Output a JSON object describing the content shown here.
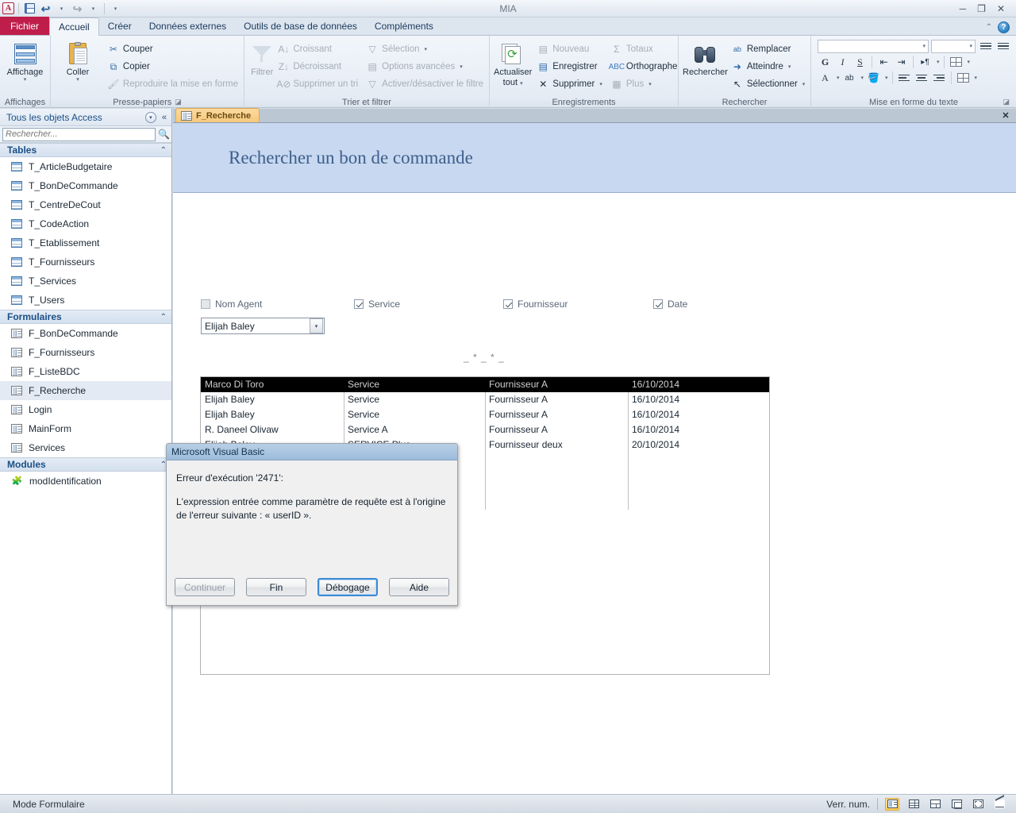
{
  "window": {
    "title": "MIA",
    "minimize": "─",
    "restore": "❐",
    "close": "✕"
  },
  "quick_access": {
    "logo": "A",
    "save": "save-icon",
    "undo": "↩",
    "redo": "↪",
    "customize": "▾"
  },
  "ribbon": {
    "file_tab": "Fichier",
    "tabs": [
      {
        "label": "Accueil",
        "active": true
      },
      {
        "label": "Créer",
        "active": false
      },
      {
        "label": "Données externes",
        "active": false
      },
      {
        "label": "Outils de base de données",
        "active": false
      },
      {
        "label": "Compléments",
        "active": false
      }
    ],
    "collapse_icon": "⌃",
    "help_icon": "?",
    "groups": {
      "views": {
        "label": "Affichages",
        "button": {
          "label": "Affichage",
          "caret": "▾"
        }
      },
      "clipboard": {
        "label": "Presse-papiers",
        "paste": {
          "label": "Coller",
          "caret": "▾"
        },
        "items": [
          {
            "label": "Couper",
            "icon": "scissors-icon",
            "disabled": false
          },
          {
            "label": "Copier",
            "icon": "copy-icon",
            "disabled": false
          },
          {
            "label": "Reproduire la mise en forme",
            "icon": "format-painter-icon",
            "disabled": true
          }
        ]
      },
      "sort_filter": {
        "label": "Trier et filtrer",
        "filter": {
          "label": "Filtrer"
        },
        "col1": [
          {
            "label": "Croissant",
            "icon": "sort-asc-icon",
            "disabled": true
          },
          {
            "label": "Décroissant",
            "icon": "sort-desc-icon",
            "disabled": true
          },
          {
            "label": "Supprimer un tri",
            "icon": "clear-sort-icon",
            "disabled": true
          }
        ],
        "col2": [
          {
            "label": "Sélection",
            "icon": "selection-icon",
            "caret": "▾",
            "disabled": true
          },
          {
            "label": "Options avancées",
            "icon": "advanced-icon",
            "caret": "▾",
            "disabled": true
          },
          {
            "label": "Activer/désactiver le filtre",
            "icon": "toggle-filter-icon",
            "disabled": true
          }
        ]
      },
      "records": {
        "label": "Enregistrements",
        "refresh": {
          "label_line1": "Actualiser",
          "label_line2": "tout",
          "caret": "▾"
        },
        "col1": [
          {
            "label": "Nouveau",
            "icon": "new-record-icon",
            "disabled": true
          },
          {
            "label": "Enregistrer",
            "icon": "save-record-icon",
            "disabled": false
          },
          {
            "label": "Supprimer",
            "icon": "delete-record-icon",
            "caret": "▾",
            "disabled": false
          }
        ],
        "col2": [
          {
            "label": "Totaux",
            "icon": "sigma-icon",
            "disabled": true
          },
          {
            "label": "Orthographe",
            "icon": "spelling-icon",
            "disabled": false
          },
          {
            "label": "Plus",
            "icon": "more-icon",
            "caret": "▾",
            "disabled": true
          }
        ]
      },
      "find": {
        "label": "Rechercher",
        "search": {
          "label": "Rechercher"
        },
        "items": [
          {
            "label": "Remplacer",
            "icon": "replace-icon"
          },
          {
            "label": "Atteindre",
            "icon": "goto-icon",
            "caret": "▾"
          },
          {
            "label": "Sélectionner",
            "icon": "select-icon",
            "caret": "▾"
          }
        ]
      },
      "text_format": {
        "label": "Mise en forme du texte",
        "font_name": "",
        "font_size": "",
        "bold": "G",
        "italic": "I",
        "underline": "S",
        "dropdown_caret": "▾",
        "dialog_launcher": "◪"
      }
    }
  },
  "navpane": {
    "title": "Tous les objets Access",
    "menu_icon": "▾",
    "collapse_icon": "«",
    "search_placeholder": "Rechercher...",
    "search_value": "",
    "search_icon": "search-icon",
    "groups": [
      {
        "name": "Tables",
        "chevron": "⌃",
        "items": [
          {
            "label": "T_ArticleBudgetaire",
            "icon": "table-icon"
          },
          {
            "label": "T_BonDeCommande",
            "icon": "table-icon"
          },
          {
            "label": "T_CentreDeCout",
            "icon": "table-icon"
          },
          {
            "label": "T_CodeAction",
            "icon": "table-icon"
          },
          {
            "label": "T_Etablissement",
            "icon": "table-icon"
          },
          {
            "label": "T_Fournisseurs",
            "icon": "table-icon"
          },
          {
            "label": "T_Services",
            "icon": "table-icon"
          },
          {
            "label": "T_Users",
            "icon": "table-icon"
          }
        ]
      },
      {
        "name": "Formulaires",
        "chevron": "⌃",
        "items": [
          {
            "label": "F_BonDeCommande",
            "icon": "form-icon"
          },
          {
            "label": "F_Fournisseurs",
            "icon": "form-icon"
          },
          {
            "label": "F_ListeBDC",
            "icon": "form-icon"
          },
          {
            "label": "F_Recherche",
            "icon": "form-icon",
            "selected": true
          },
          {
            "label": "Login",
            "icon": "form-icon"
          },
          {
            "label": "MainForm",
            "icon": "form-icon"
          },
          {
            "label": "Services",
            "icon": "form-icon"
          }
        ]
      },
      {
        "name": "Modules",
        "chevron": "⌃",
        "items": [
          {
            "label": "modIdentification",
            "icon": "module-icon"
          }
        ]
      }
    ]
  },
  "document": {
    "tab_label": "F_Recherche",
    "tab_icon": "form-icon",
    "close_icon": "✕",
    "form_title": "Rechercher un bon de commande",
    "separator": "_ * _ * _",
    "criteria": [
      {
        "label": "Nom Agent",
        "checked": false
      },
      {
        "label": "Service",
        "checked": true
      },
      {
        "label": "Fournisseur",
        "checked": true
      },
      {
        "label": "Date",
        "checked": true
      }
    ],
    "combo": {
      "value": "Elijah Baley",
      "caret": "▾"
    },
    "results": {
      "header": [
        "Marco Di Toro",
        "Service",
        "Fournisseur A",
        "16/10/2014"
      ],
      "rows": [
        [
          "Elijah Baley",
          "Service",
          "Fournisseur A",
          "16/10/2014"
        ],
        [
          "Elijah Baley",
          "Service",
          "Fournisseur A",
          "16/10/2014"
        ],
        [
          "R. Daneel Olivaw",
          "Service A",
          "Fournisseur A",
          "16/10/2014"
        ],
        [
          "Elijah Baley",
          "SERVICE Plus",
          "Fournisseur deux",
          "20/10/2014"
        ]
      ]
    }
  },
  "dialog": {
    "title": "Microsoft Visual Basic",
    "line1": "Erreur d'exécution '2471':",
    "line2": "L'expression entrée comme paramètre de requête est à l'origine de l'erreur suivante : « userID ».",
    "buttons": [
      {
        "label": "Continuer",
        "disabled": true,
        "focused": false
      },
      {
        "label": "Fin",
        "disabled": false,
        "focused": false
      },
      {
        "label": "Débogage",
        "disabled": false,
        "focused": true
      },
      {
        "label": "Aide",
        "disabled": false,
        "focused": false
      }
    ]
  },
  "statusbar": {
    "mode": "Mode Formulaire",
    "numlock": "Verr. num.",
    "views": [
      {
        "name": "form-view",
        "active": true
      },
      {
        "name": "datasheet-view",
        "active": false
      },
      {
        "name": "pivottable-view",
        "active": false
      },
      {
        "name": "layout-view",
        "active": false
      },
      {
        "name": "design-view",
        "active": false
      },
      {
        "name": "pivotchart-view",
        "active": false
      }
    ]
  },
  "colors": {
    "file_tab": "#bf1e4b",
    "form_header": "#c7d8f0",
    "form_title": "#3e5f8c",
    "grid_header_bg": "#000000",
    "accent": "#1b4f86"
  }
}
